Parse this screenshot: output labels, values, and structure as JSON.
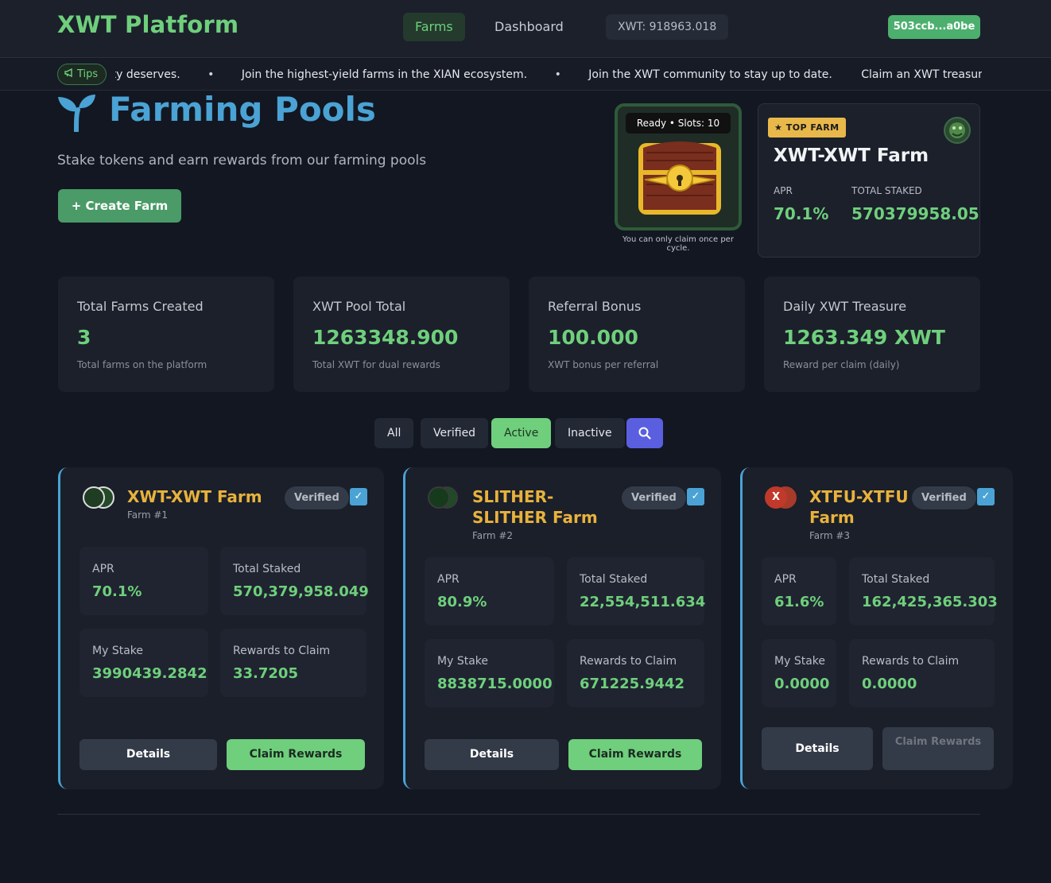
{
  "header": {
    "brand": "XWT Platform",
    "nav": [
      {
        "label": "Farms"
      },
      {
        "label": "Dashboard"
      }
    ],
    "balance": "XWT: 918963.018",
    "wallet": "503ccb...a0be"
  },
  "ticker": {
    "tips_label": "Tips",
    "items": [
      "unity deserves.",
      "Join the highest-yield farms in the XIAN ecosystem.",
      "Join the XWT community to stay up to date.",
      "Claim an XWT treasure loot every"
    ],
    "separator": "•"
  },
  "hero": {
    "title": "Farming Pools",
    "subtitle": "Stake tokens and earn rewards from our farming pools",
    "create_label": "+ Create Farm"
  },
  "treasure": {
    "status": "Ready • Slots: 10",
    "note": "You can only claim once per cycle."
  },
  "top_farm": {
    "badge": "★ TOP FARM",
    "title": "XWT-XWT Farm",
    "apr_label": "APR",
    "apr_value": "70.1%",
    "staked_label": "TOTAL STAKED",
    "staked_value": "570379958.05"
  },
  "stats": [
    {
      "label": "Total Farms Created",
      "value": "3",
      "sub": "Total farms on the platform"
    },
    {
      "label": "XWT Pool Total",
      "value": "1263348.900",
      "sub": "Total XWT for dual rewards"
    },
    {
      "label": "Referral Bonus",
      "value": "100.000",
      "sub": "XWT bonus per referral"
    },
    {
      "label": "Daily XWT Treasure",
      "value": "1263.349 XWT",
      "sub": "Reward per claim (daily)"
    }
  ],
  "filters": [
    {
      "label": "All"
    },
    {
      "label": "Verified"
    },
    {
      "label": "Active"
    },
    {
      "label": "Inactive"
    }
  ],
  "farms": [
    {
      "title": "XWT-XWT Farm",
      "sub": "Farm #1",
      "verified": "Verified",
      "check": "✓",
      "apr_label": "APR",
      "apr": "70.1%",
      "staked_label": "Total Staked",
      "staked": "570,379,958.049",
      "mystake_label": "My Stake",
      "mystake": "3990439.2842",
      "rewards_label": "Rewards to Claim",
      "rewards": "33.7205",
      "details_label": "Details",
      "claim_label": "Claim Rewards"
    },
    {
      "title": "SLITHER-SLITHER Farm",
      "sub": "Farm #2",
      "verified": "Verified",
      "check": "✓",
      "apr_label": "APR",
      "apr": "80.9%",
      "staked_label": "Total Staked",
      "staked": "22,554,511.634",
      "mystake_label": "My Stake",
      "mystake": "8838715.0000",
      "rewards_label": "Rewards to Claim",
      "rewards": "671225.9442",
      "details_label": "Details",
      "claim_label": "Claim Rewards"
    },
    {
      "title": "XTFU-XTFU Farm",
      "sub": "Farm #3",
      "verified": "Verified",
      "check": "✓",
      "avatar_letter": "X",
      "apr_label": "APR",
      "apr": "61.6%",
      "staked_label": "Total Staked",
      "staked": "162,425,365.303",
      "mystake_label": "My Stake",
      "mystake": "0.0000",
      "rewards_label": "Rewards to Claim",
      "rewards": "0.0000",
      "details_label": "Details",
      "claim_label": "Claim Rewards"
    }
  ]
}
